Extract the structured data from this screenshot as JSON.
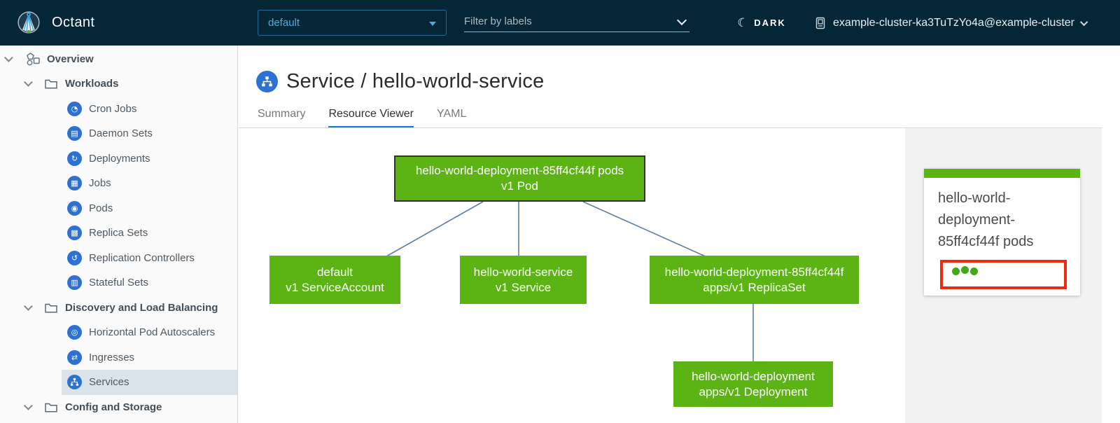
{
  "colors": {
    "header_bg": "#042637",
    "accent_blue": "#49afd9",
    "icon_blue": "#2d72d2",
    "node_green": "#5cb414",
    "alert_red": "#f02b0b",
    "tab_underline": "#0f7fc4",
    "selected_row_bg": "#dbe3ea"
  },
  "icons": {
    "cronjobs": "◔",
    "daemonsets": "▤",
    "deployments": "↻",
    "jobs": "▦",
    "pods": "◉",
    "replicasets": "▩",
    "replication_controllers": "↺",
    "statefulsets": "▥",
    "hpa": "◎",
    "ingresses": "⇄",
    "moon": "☾"
  },
  "header": {
    "app_name": "Octant",
    "namespace_select": {
      "value": "default"
    },
    "filter": {
      "placeholder": "Filter by labels"
    },
    "theme_toggle": {
      "label": "DARK"
    },
    "cluster_context": {
      "label": "example-cluster-ka3TuTzYo4a@example-cluster"
    }
  },
  "sidebar": {
    "items": [
      {
        "label": "Overview"
      },
      {
        "label": "Workloads"
      },
      {
        "label": "Cron Jobs"
      },
      {
        "label": "Daemon Sets"
      },
      {
        "label": "Deployments"
      },
      {
        "label": "Jobs"
      },
      {
        "label": "Pods"
      },
      {
        "label": "Replica Sets"
      },
      {
        "label": "Replication Controllers"
      },
      {
        "label": "Stateful Sets"
      },
      {
        "label": "Discovery and Load Balancing"
      },
      {
        "label": "Horizontal Pod Autoscalers"
      },
      {
        "label": "Ingresses"
      },
      {
        "label": "Services",
        "selected": true
      },
      {
        "label": "Config and Storage"
      }
    ]
  },
  "main": {
    "title": "Service / hello-world-service",
    "tabs": [
      {
        "label": "Summary",
        "active": false
      },
      {
        "label": "Resource Viewer",
        "active": true
      },
      {
        "label": "YAML",
        "active": false
      }
    ]
  },
  "graph": {
    "nodes": [
      {
        "name": "hello-world-deployment-85ff4cf44f pods",
        "kind": "v1 Pod",
        "selected": true
      },
      {
        "name": "default",
        "kind": "v1 ServiceAccount"
      },
      {
        "name": "hello-world-service",
        "kind": "v1 Service"
      },
      {
        "name": "hello-world-deployment-85ff4cf44f",
        "kind": "apps/v1 ReplicaSet"
      },
      {
        "name": "hello-world-deployment",
        "kind": "apps/v1 Deployment"
      }
    ]
  },
  "side_panel": {
    "card": {
      "title": "hello-world-deployment-85ff4cf44f pods",
      "pod_status_dots": 3
    }
  }
}
